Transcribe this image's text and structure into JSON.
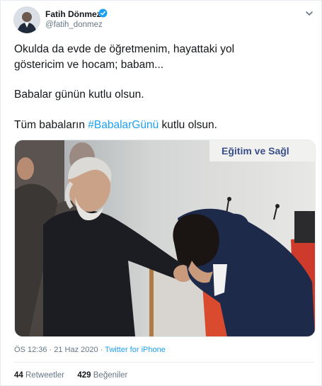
{
  "user": {
    "name": "Fatih Dönmez",
    "handle": "@fatih_donmez",
    "verified": true
  },
  "tweet": {
    "line1": "Okulda da evde de öğretmenim, hayattaki yol",
    "line2": "göstericim ve hocam; babam...",
    "line3": "Babalar günün kutlu olsun.",
    "line4_pre": "Tüm babaların ",
    "hashtag": "#BabalarGünü",
    "line4_post": " kutlu olsun."
  },
  "photo": {
    "banner_text": "Eğitim ve Sağl"
  },
  "meta": {
    "time": "ÖS 12:36",
    "sep": " · ",
    "date": "21 Haz 2020",
    "source": "Twitter for iPhone"
  },
  "stats": {
    "retweets_count": "44",
    "retweets_label": "Retweetler",
    "likes_count": "429",
    "likes_label": "Beğeniler"
  },
  "colors": {
    "accent": "#1da1f2",
    "text": "#14171a",
    "muted": "#657786"
  },
  "icons": {
    "verified": "verified-badge-icon",
    "caret": "chevron-down-icon"
  }
}
